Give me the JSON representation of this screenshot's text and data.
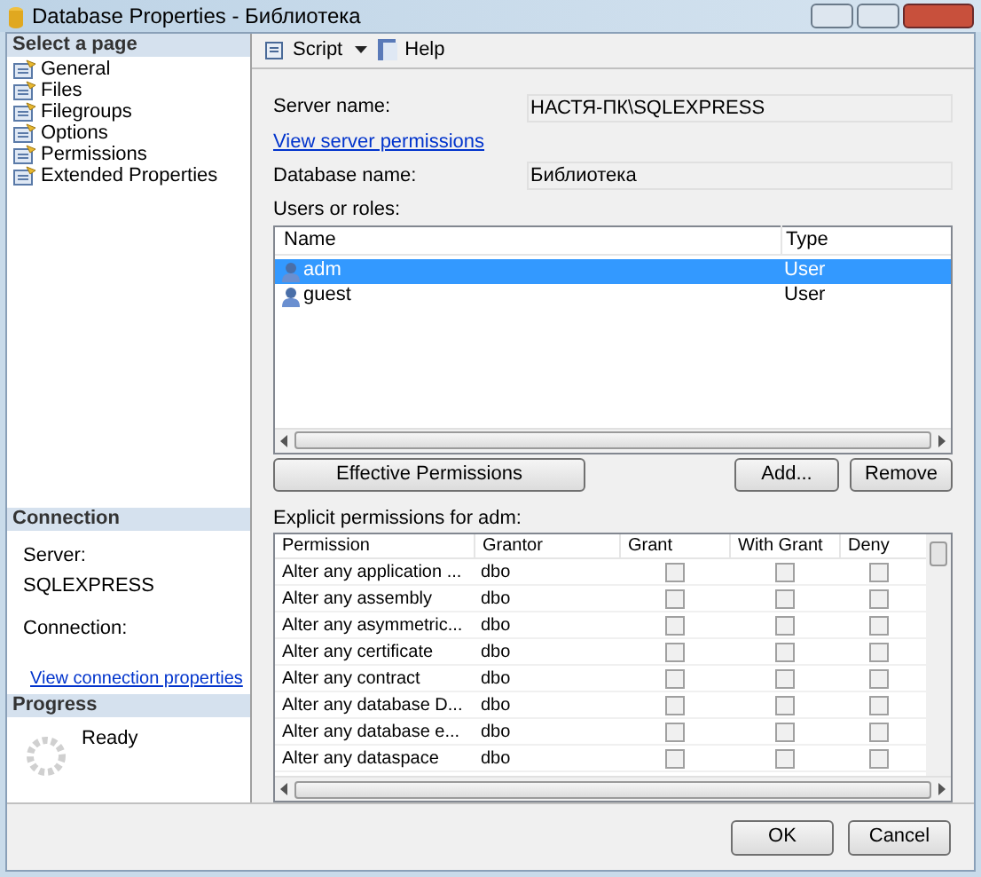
{
  "window": {
    "title": "Database Properties - Библиотека"
  },
  "sidebar": {
    "header": "Select a page",
    "items": [
      "General",
      "Files",
      "Filegroups",
      "Options",
      "Permissions",
      "Extended Properties"
    ]
  },
  "connection": {
    "header": "Connection",
    "server_label": "Server:",
    "server_value": "SQLEXPRESS",
    "connection_label": "Connection:",
    "link": "View connection properties"
  },
  "progress": {
    "header": "Progress",
    "status": "Ready"
  },
  "toolbar": {
    "script": "Script",
    "help": "Help"
  },
  "server": {
    "label": "Server name:",
    "value": "НАСТЯ-ПК\\SQLEXPRESS",
    "link": "View server permissions"
  },
  "database": {
    "label": "Database name:",
    "value": "Библиотека"
  },
  "users": {
    "label": "Users or roles:",
    "columns": [
      "Name",
      "Type"
    ],
    "rows": [
      {
        "name": "adm",
        "type": "User",
        "selected": true
      },
      {
        "name": "guest",
        "type": "User",
        "selected": false
      }
    ]
  },
  "buttons": {
    "effective": "Effective Permissions",
    "add": "Add...",
    "remove": "Remove"
  },
  "permissions": {
    "label": "Explicit permissions for adm:",
    "columns": [
      "Permission",
      "Grantor",
      "Grant",
      "With Grant",
      "Deny"
    ],
    "rows": [
      {
        "permission": "Alter any application ...",
        "grantor": "dbo",
        "grant": false,
        "with_grant": false,
        "deny": false
      },
      {
        "permission": "Alter any assembly",
        "grantor": "dbo",
        "grant": false,
        "with_grant": false,
        "deny": false
      },
      {
        "permission": "Alter any asymmetric...",
        "grantor": "dbo",
        "grant": false,
        "with_grant": false,
        "deny": false
      },
      {
        "permission": "Alter any certificate",
        "grantor": "dbo",
        "grant": false,
        "with_grant": false,
        "deny": false
      },
      {
        "permission": "Alter any contract",
        "grantor": "dbo",
        "grant": false,
        "with_grant": false,
        "deny": false
      },
      {
        "permission": "Alter any database D...",
        "grantor": "dbo",
        "grant": false,
        "with_grant": false,
        "deny": false
      },
      {
        "permission": "Alter any database e...",
        "grantor": "dbo",
        "grant": false,
        "with_grant": false,
        "deny": false
      },
      {
        "permission": "Alter any dataspace",
        "grantor": "dbo",
        "grant": false,
        "with_grant": false,
        "deny": false
      }
    ]
  },
  "footer": {
    "ok": "OK",
    "cancel": "Cancel"
  }
}
